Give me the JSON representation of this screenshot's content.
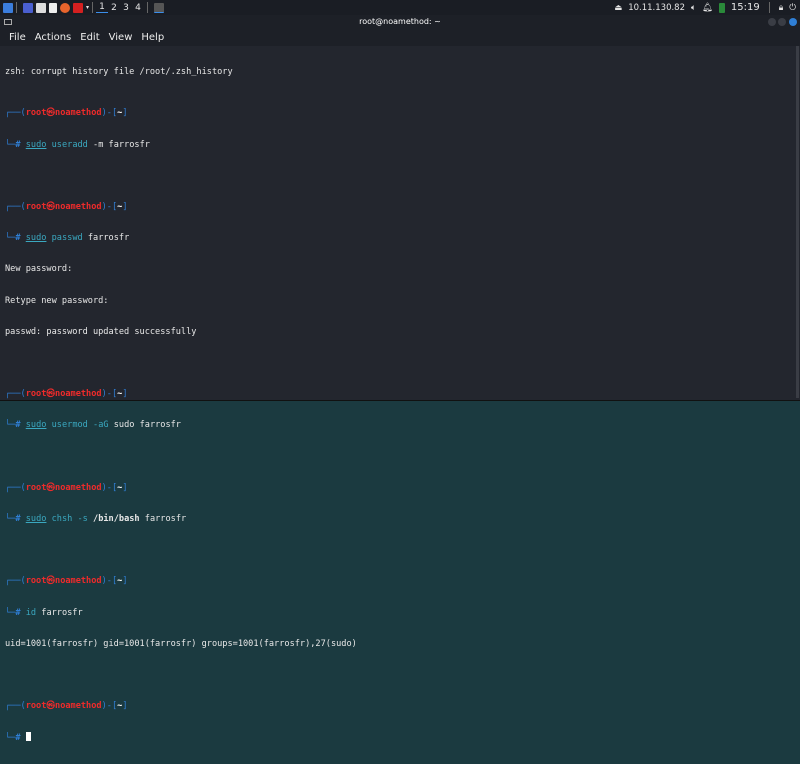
{
  "taskbar": {
    "workspaces": [
      "1",
      "2",
      "3",
      "4"
    ],
    "ip": "10.11.130.82",
    "clock": "15:19"
  },
  "window": {
    "title": "root@noamethod: ~",
    "menu": [
      "File",
      "Actions",
      "Edit",
      "View",
      "Help"
    ]
  },
  "prompt": {
    "user": "root",
    "host": "noamethod",
    "dir": "~",
    "at": "㉿",
    "hash": "#"
  },
  "terminal": {
    "warning": "zsh: corrupt history file /root/.zsh_history",
    "cmd1": {
      "a": "sudo",
      "b": "useradd",
      "c": " -m farrosfr"
    },
    "cmd2": {
      "a": "sudo",
      "b": "passwd",
      "c": " farrosfr"
    },
    "out2": [
      "New password:",
      "Retype new password:",
      "passwd: password updated successfully"
    ],
    "cmd3": {
      "a": "sudo",
      "b": "usermod",
      "c": " -aG",
      "d": " sudo farrosfr"
    },
    "cmd4": {
      "a": "sudo",
      "b": "chsh",
      "c": " -s",
      "d": " /bin/bash",
      "e": " farrosfr"
    },
    "cmd5": {
      "b": "id",
      "c": " farrosfr"
    },
    "out5": "uid=1001(farrosfr) gid=1001(farrosfr) groups=1001(farrosfr),27(sudo)"
  }
}
